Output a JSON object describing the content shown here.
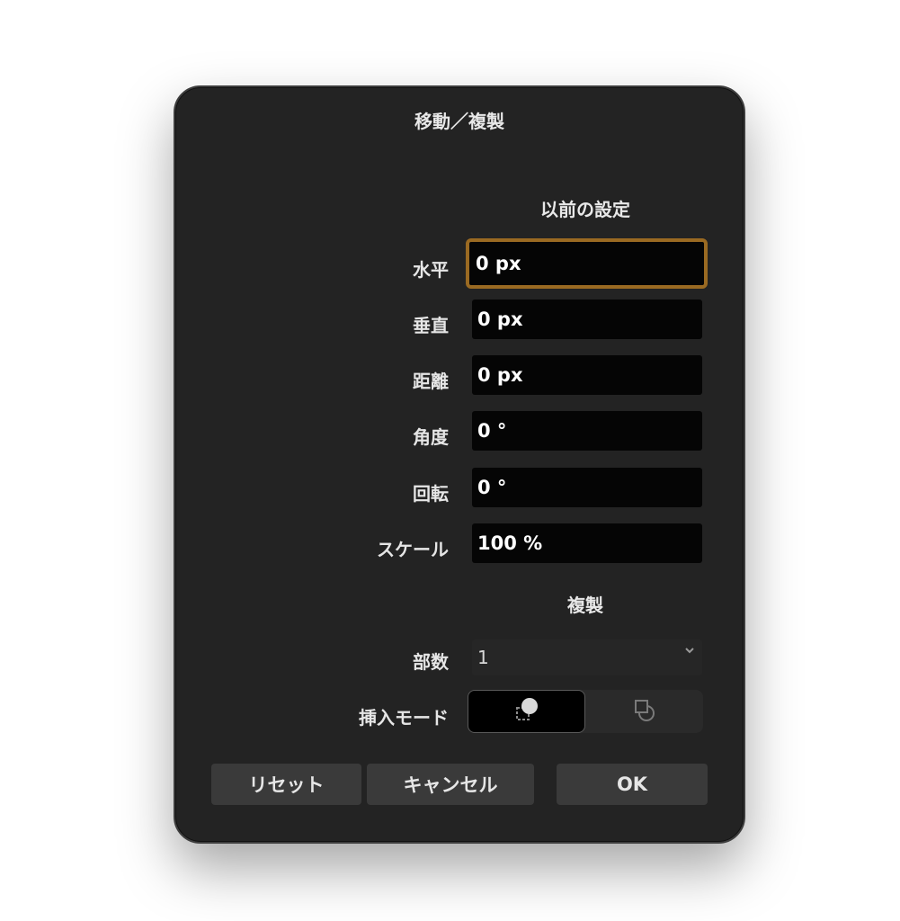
{
  "dialog": {
    "title": "移動／複製"
  },
  "previous_settings": {
    "heading": "以前の設定",
    "fields": [
      {
        "label": "水平",
        "value": "0 px"
      },
      {
        "label": "垂直",
        "value": "0 px"
      },
      {
        "label": "距離",
        "value": "0 px"
      },
      {
        "label": "角度",
        "value": "0 °"
      },
      {
        "label": "回転",
        "value": "0 °"
      },
      {
        "label": "スケール",
        "value": "100 %"
      }
    ]
  },
  "duplicate": {
    "heading": "複製",
    "copies_label": "部数",
    "copies_value": "1",
    "insert_mode_label": "挿入モード",
    "insert_mode_options": [
      {
        "icon": "insert-above-icon",
        "selected": true
      },
      {
        "icon": "insert-below-icon",
        "selected": false
      }
    ]
  },
  "buttons": {
    "reset": "リセット",
    "cancel": "キャンセル",
    "ok": "OK"
  },
  "colors": {
    "dialog_bg": "#232323",
    "focus_ring": "#9a6a22",
    "field_bg": "#050505",
    "button_bg": "#3a3a3a"
  }
}
